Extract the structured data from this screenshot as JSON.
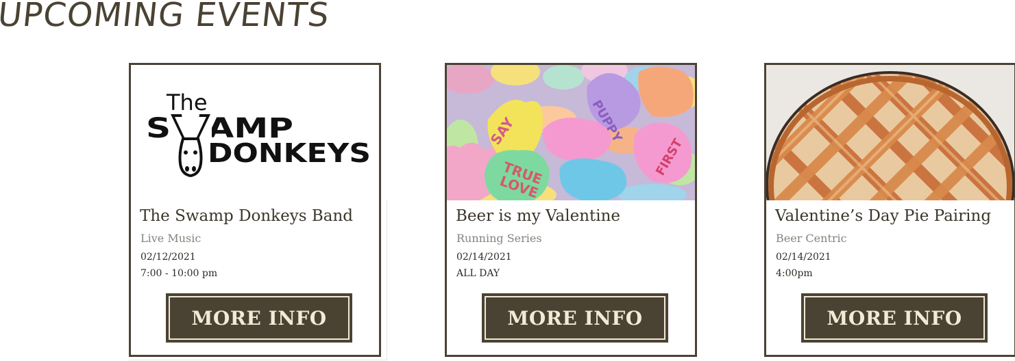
{
  "section": {
    "title": "UPCOMING EVENTS"
  },
  "logo": {
    "the": "The",
    "swamp": "SWAMP",
    "donkeys": "DONKEYS"
  },
  "events": [
    {
      "title": "The Swamp Donkeys Band",
      "category": "Live Music",
      "date": "02/12/2021",
      "time": "7:00 - 10:00 pm",
      "button_label": "MORE INFO",
      "image_icon": "swamp-donkeys-logo"
    },
    {
      "title": "Beer is my Valentine",
      "category": "Running Series",
      "date": "02/14/2021",
      "time": "ALL DAY",
      "button_label": "MORE INFO",
      "image_icon": "candy-hearts-photo"
    },
    {
      "title": "Valentine’s Day Pie Pairing",
      "category": "Beer Centric",
      "date": "02/14/2021",
      "time": "4:00pm",
      "button_label": "MORE INFO",
      "image_icon": "lattice-pie-photo"
    }
  ],
  "colors": {
    "brand_brown": "#4a4233",
    "button_text": "#f2ead6",
    "category_gray": "#86837c"
  }
}
